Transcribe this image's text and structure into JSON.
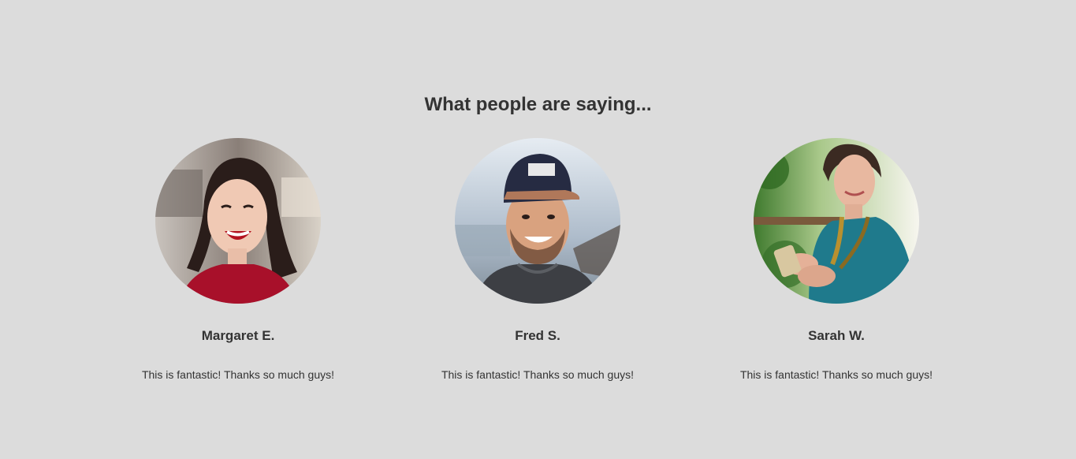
{
  "section": {
    "heading": "What people are saying..."
  },
  "testimonials": [
    {
      "name": "Margaret E.",
      "quote": "This is fantastic! Thanks so much guys!",
      "avatar_icon": "woman-smiling-photo"
    },
    {
      "name": "Fred S.",
      "quote": "This is fantastic! Thanks so much guys!",
      "avatar_icon": "man-in-cap-photo"
    },
    {
      "name": "Sarah W.",
      "quote": "This is fantastic! Thanks so much guys!",
      "avatar_icon": "woman-with-phone-photo"
    }
  ],
  "colors": {
    "background": "#dcdcdc",
    "text": "#333333"
  }
}
